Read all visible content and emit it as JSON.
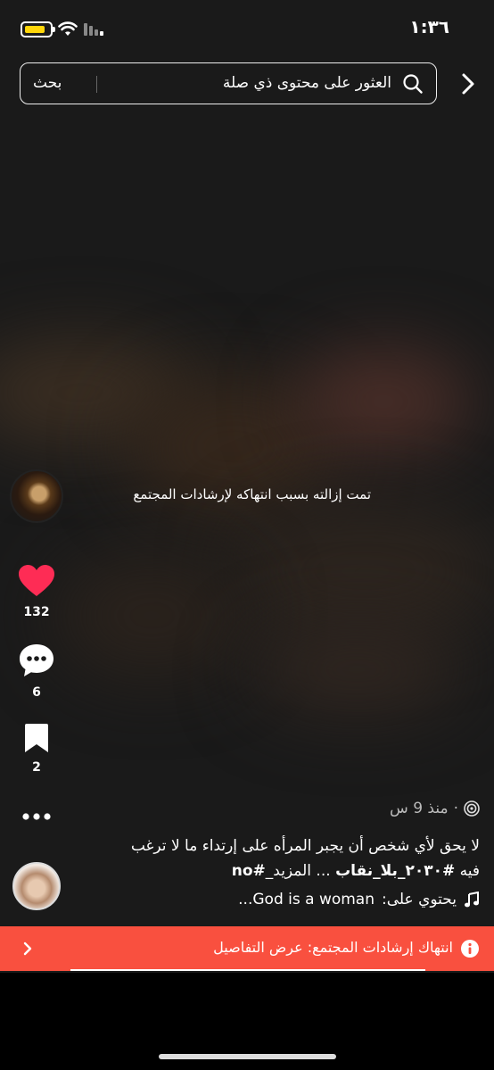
{
  "status_bar": {
    "time": "١:٣٦",
    "battery_color": "#ffd60a"
  },
  "search": {
    "placeholder": "العثور على محتوى ذي صلة",
    "button_label": "بحث"
  },
  "video": {
    "removed_message": "تمت إزالته بسبب انتهاكه لإرشادات المجتمع"
  },
  "actions": {
    "likes": "132",
    "comments": "6",
    "saves": "2",
    "like_color": "#fe2c55"
  },
  "post": {
    "time_ago": "منذ 9 س",
    "caption_line1": "لا يحق لأي شخص أن يجبر المرأه على إرتداء ما لا ترغب",
    "caption_line2_prefix": "فيه ",
    "hashtag1": "#٢٠٣٠_بلا_نقاب",
    "caption_more": " ... المزيد_",
    "hashtag2": "#no",
    "music_prefix": "يحتوي على: ",
    "music_title": "...God is a woman"
  },
  "violation_banner": {
    "text": "انتهاك إرشادات المجتمع: عرض التفاصيل",
    "color": "#f9503f"
  }
}
